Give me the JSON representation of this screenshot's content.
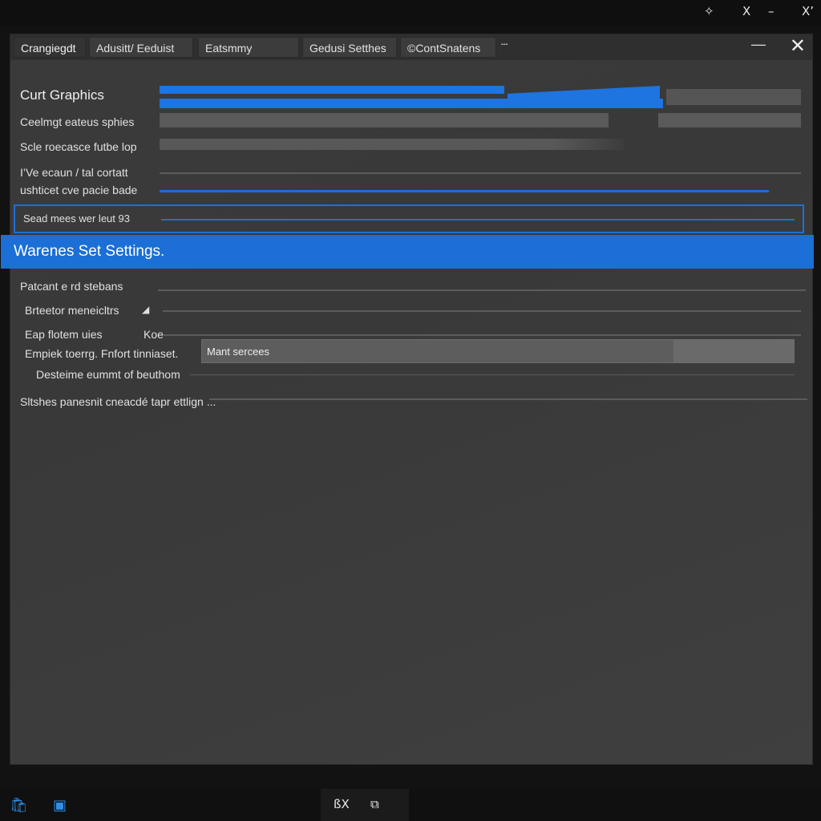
{
  "titlebar": {
    "controls": [
      "✧",
      "X",
      "–",
      "X’"
    ]
  },
  "tabs": [
    {
      "label": "Crangiegdt",
      "active": true
    },
    {
      "label": "Adusitt/ Eeduist",
      "active": false
    },
    {
      "label": "Eatsmmy",
      "active": false
    },
    {
      "label": "Gedusi Setthes",
      "active": false
    },
    {
      "label": "©ContSnatens",
      "active": false
    }
  ],
  "window_controls": {
    "minimize": "—",
    "close": "✕"
  },
  "rows": {
    "graphics": "Curt Graphics",
    "row2": "Ceelmgt eateus sphies",
    "row3": "Scle roecasce futbe lop",
    "row4a": "I’Ve ecaun / tal cortatt",
    "row4b": "ushticet cve pacie bade",
    "framed": "Sead mees wer leut 93",
    "highlight": "Warenes Set Settings.",
    "row6": "Patcant e rd stebans",
    "row7": "Brteetor meneicltrs",
    "row8a": "Eap flotem uies",
    "row8b": "Koe",
    "row9": "Empiek toerrg. Fnfort tinniaset.",
    "field_value": "Mant sercees",
    "row10": "Desteime eummt of beuthom",
    "row11": "Sltshes panesnit cneacdé tapr ettlign ..."
  },
  "colors": {
    "accent": "#1b6fd6",
    "window_bg": "#3a3a3a",
    "taskbar": "#101010"
  },
  "taskbar": {
    "left_icons": [
      "store-icon",
      "browser-icon"
    ],
    "center_labels": [
      "ßX",
      "⧉"
    ]
  }
}
